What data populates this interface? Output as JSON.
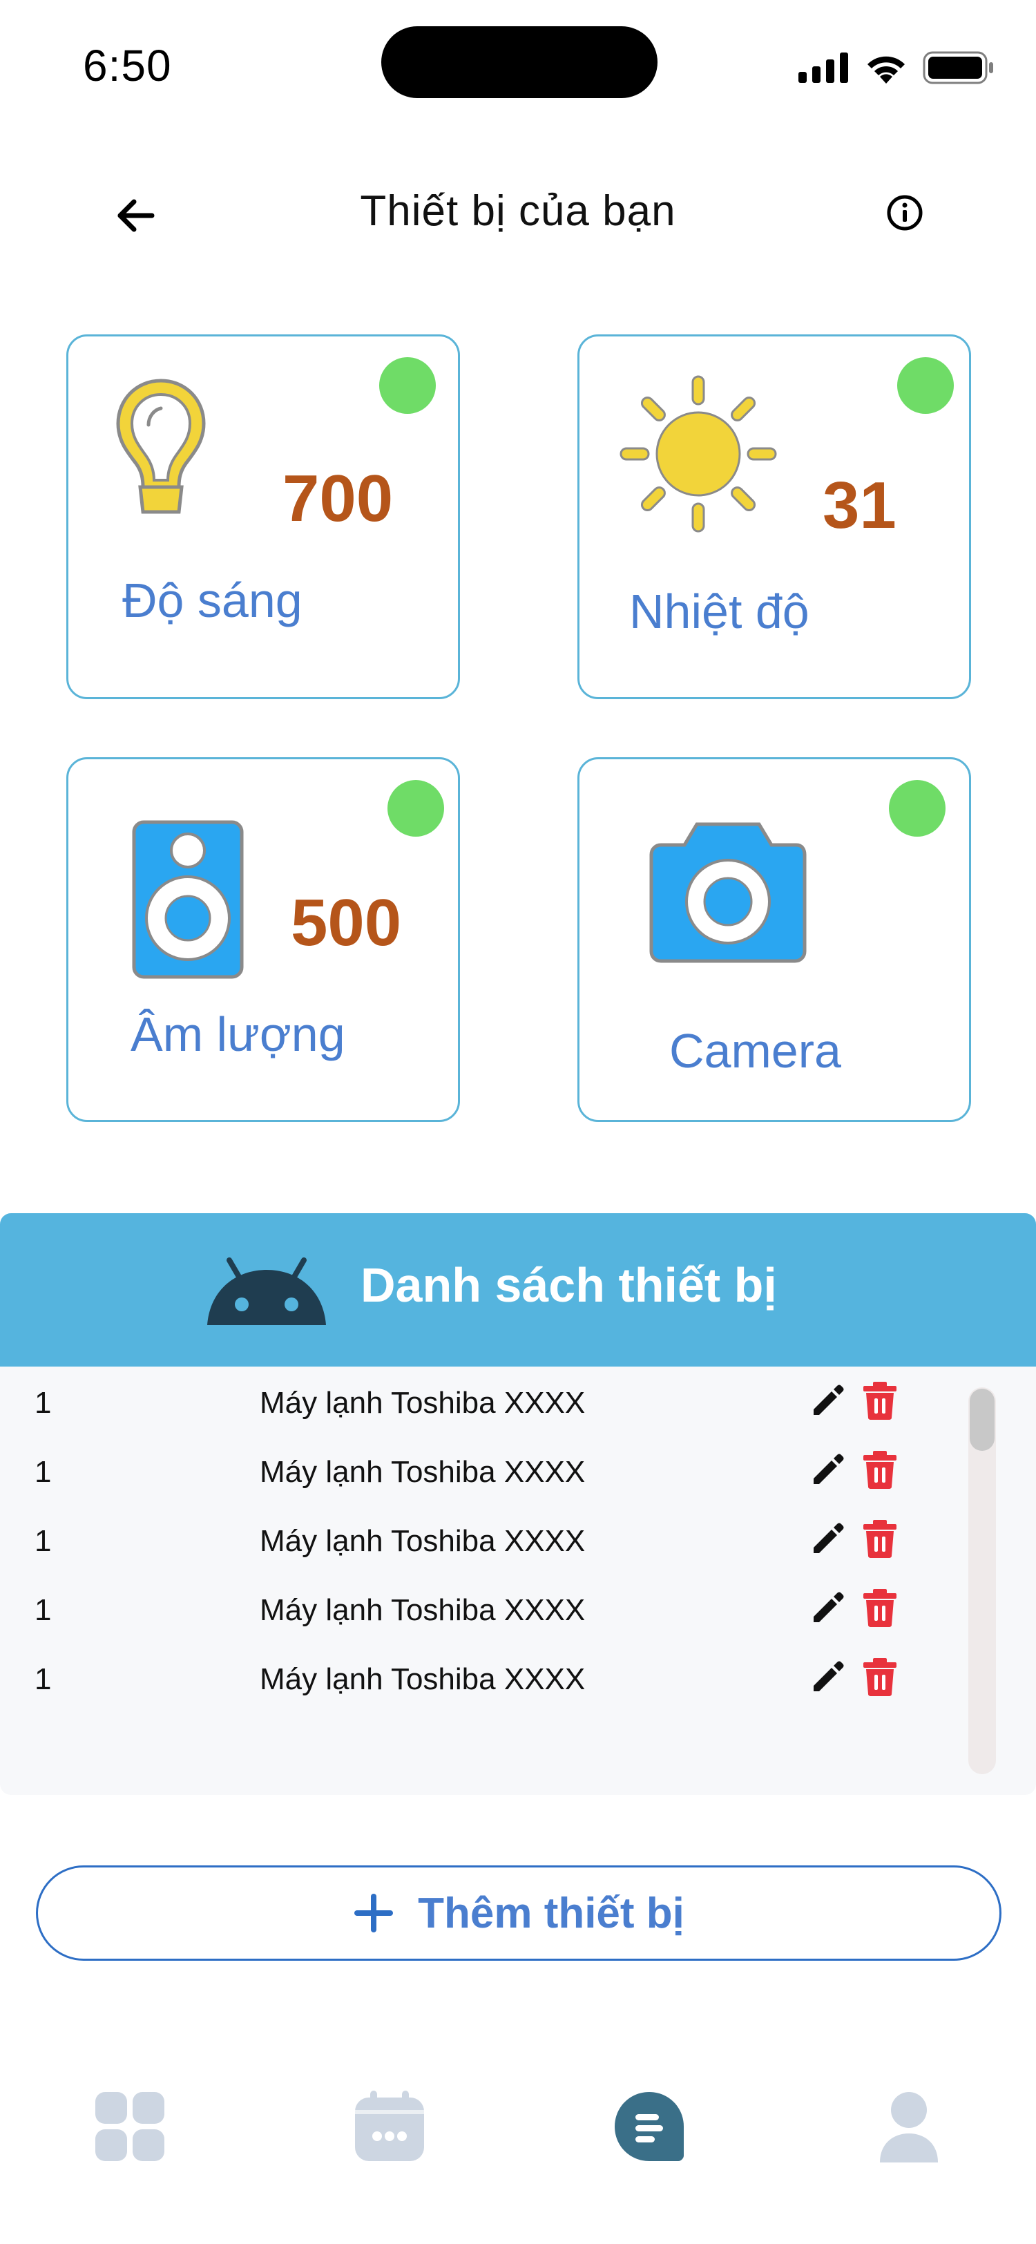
{
  "status_bar": {
    "time": "6:50",
    "icons": [
      "signal-icon",
      "wifi-icon",
      "battery-icon"
    ]
  },
  "header": {
    "title": "Thiết bị của bạn",
    "back_icon": "arrow-left-icon",
    "info_icon": "info-icon"
  },
  "devices": [
    {
      "label": "Độ sáng",
      "value": "700",
      "icon": "lightbulb-icon",
      "status_color": "#6fdc67"
    },
    {
      "label": "Nhiệt độ",
      "value": "31",
      "icon": "sun-icon",
      "status_color": "#6fdc67"
    },
    {
      "label": "Âm lượng",
      "value": "500",
      "icon": "speaker-icon",
      "status_color": "#6fdc67"
    },
    {
      "label": "Camera",
      "value": "",
      "icon": "camera-icon",
      "status_color": "#6fdc67"
    }
  ],
  "device_list": {
    "title": "Danh sách thiết bị",
    "icon": "android-icon",
    "rows": [
      {
        "num": "1",
        "name": "Máy lạnh Toshiba XXXX"
      },
      {
        "num": "1",
        "name": "Máy lạnh Toshiba XXXX"
      },
      {
        "num": "1",
        "name": "Máy lạnh Toshiba XXXX"
      },
      {
        "num": "1",
        "name": "Máy lạnh Toshiba XXXX"
      },
      {
        "num": "1",
        "name": "Máy lạnh Toshiba XXXX"
      }
    ],
    "row_actions": [
      "pencil-icon",
      "trash-icon"
    ]
  },
  "add_button": {
    "label": "Thêm thiết bị",
    "icon": "plus-icon"
  },
  "bottom_nav": {
    "items": [
      "grid-icon",
      "calendar-icon",
      "chat-icon",
      "user-icon"
    ],
    "active_index": 2
  },
  "colors": {
    "card_border": "#5ab4d8",
    "value": "#b5551a",
    "label": "#4a7ecf",
    "status_online": "#6fdc67",
    "list_header": "#55b4de",
    "delete": "#e8323c",
    "nav_active": "#3a6f88",
    "nav_inactive": "#cdd6e2"
  }
}
